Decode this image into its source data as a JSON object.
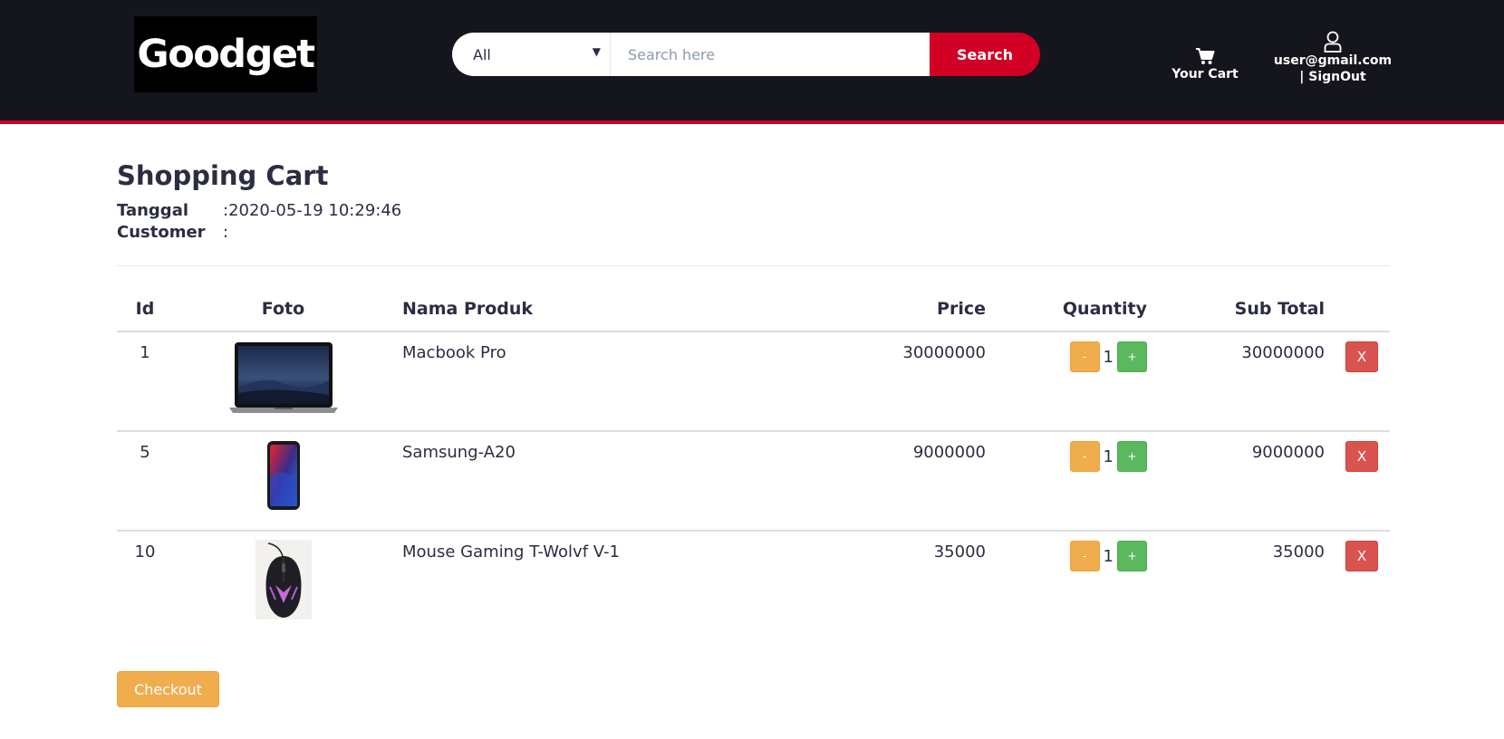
{
  "header": {
    "logo_text": "Goodget",
    "search": {
      "category": "All",
      "placeholder": "Search here",
      "button_label": "Search"
    },
    "cart_label": "Your Cart",
    "user_email": "user@gmail.com",
    "signout_label": "| SignOut"
  },
  "cart": {
    "title": "Shopping Cart",
    "tanggal_label": "Tanggal",
    "tanggal_value": ":2020-05-19 10:29:46",
    "customer_label": "Customer",
    "customer_value": ":",
    "columns": {
      "id": "Id",
      "foto": "Foto",
      "name": "Nama Produk",
      "price": "Price",
      "quantity": "Quantity",
      "subtotal": "Sub Total"
    },
    "items": [
      {
        "id": "1",
        "name": "Macbook Pro",
        "price": "30000000",
        "qty": "1",
        "subtotal": "30000000"
      },
      {
        "id": "5",
        "name": "Samsung-A20",
        "price": "9000000",
        "qty": "1",
        "subtotal": "9000000"
      },
      {
        "id": "10",
        "name": "Mouse Gaming T-Wolvf V-1",
        "price": "35000",
        "qty": "1",
        "subtotal": "35000"
      }
    ],
    "minus_label": "-",
    "plus_label": "+",
    "remove_label": "X",
    "checkout_label": "Checkout"
  },
  "colors": {
    "header_bg": "#15161d",
    "accent": "#d10024",
    "warning": "#f0ad4e",
    "success": "#5cb85c",
    "danger": "#d9534f"
  }
}
